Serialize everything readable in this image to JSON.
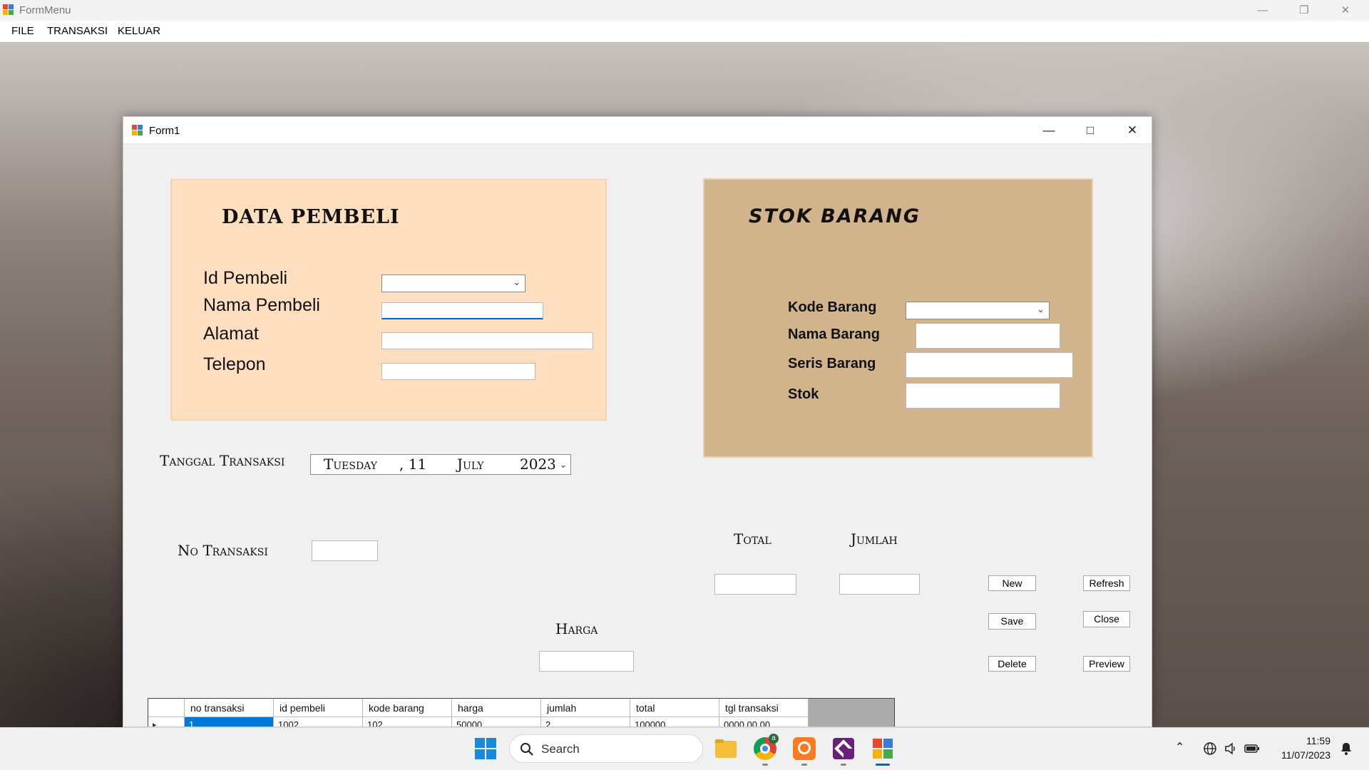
{
  "main_window": {
    "title": "FormMenu",
    "menu": [
      "FILE",
      "TRANSAKSI",
      "KELUAR"
    ]
  },
  "form": {
    "title": "Form1",
    "pembeli": {
      "heading": "DATA PEMBELI",
      "fields": {
        "id": "Id Pembeli",
        "nama": "Nama Pembeli",
        "alamat": "Alamat",
        "telepon": "Telepon"
      },
      "values": {
        "id": "",
        "nama": "",
        "alamat": "",
        "telepon": ""
      }
    },
    "stok": {
      "heading": "STOK BARANG",
      "fields": {
        "kode": "Kode Barang",
        "nama": "Nama Barang",
        "seris": "Seris Barang",
        "stok": "Stok"
      },
      "values": {
        "kode": "",
        "nama": "",
        "seris": "",
        "stok": ""
      }
    },
    "tanggal": {
      "label": "Tanggal Transaksi",
      "day": "Tuesday",
      "sep": ", 11",
      "month": "July",
      "year": "2023"
    },
    "no_transaksi": {
      "label": "No Transaksi",
      "value": ""
    },
    "harga": {
      "label": "Harga",
      "value": ""
    },
    "total": {
      "label": "Total",
      "value": ""
    },
    "jumlah": {
      "label": "Jumlah",
      "value": ""
    },
    "buttons": {
      "new": "New",
      "refresh": "Refresh",
      "save": "Save",
      "close": "Close",
      "delete": "Delete",
      "preview": "Preview"
    },
    "grid": {
      "columns": [
        "no transaksi",
        "id pembeli",
        "kode barang",
        "harga",
        "jumlah",
        "total",
        "tgl transaksi"
      ],
      "row": [
        "1",
        "1002",
        "102",
        "50000",
        "2",
        "100000",
        "0000 00 00"
      ],
      "row_marker": "▸"
    }
  },
  "taskbar": {
    "search_placeholder": "Search",
    "time": "11:59",
    "date": "11/07/2023",
    "chrome_badge": "a"
  },
  "icons": [
    "app-icon",
    "minimize-icon",
    "restore-icon",
    "close-icon",
    "dropdown-chevron-icon",
    "windows-start-icon",
    "search-icon",
    "file-explorer-icon",
    "chrome-icon",
    "xampp-icon",
    "visual-studio-icon",
    "winforms-app-icon",
    "chevron-up-icon",
    "globe-icon",
    "volume-icon",
    "battery-icon",
    "notification-icon"
  ]
}
